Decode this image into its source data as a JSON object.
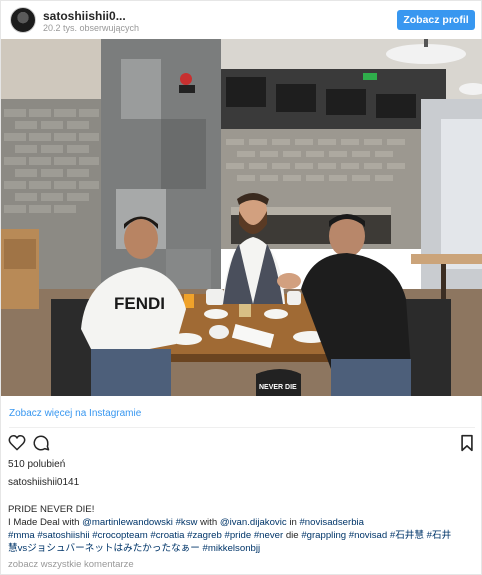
{
  "header": {
    "username": "satoshiishii0...",
    "followers": "20.2 tys. obserwujących",
    "profile_button": "Zobacz profil"
  },
  "photo": {
    "shirt_text": "FENDI",
    "bag_text": "NEVER DIE"
  },
  "more_link": "Zobacz więcej na Instagramie",
  "likes": "510 polubień",
  "poster": "satoshiishii0141",
  "caption": {
    "line1": "PRIDE NEVER DIE!",
    "line2_prefix": "I Made Deal with ",
    "mention1": "@martinlewandowski",
    "tag_ksw": " #ksw",
    "line2_with": " with ",
    "mention2": "@ivan.dijakovic",
    "line2_in": " in ",
    "tag_novisad": "#novisadserbia",
    "line3": "#mma #satoshiishii #crocopteam #croatia #zagreb #pride #never",
    "line3_die": " die ",
    "line3_rest": "#grappling #novisad #石井慧 #石井",
    "line4": "慧vsジョシュバーネットはみたかったなぁー #mikkelsonbjj"
  },
  "comments_link": "zobacz wszystkie komentarze"
}
